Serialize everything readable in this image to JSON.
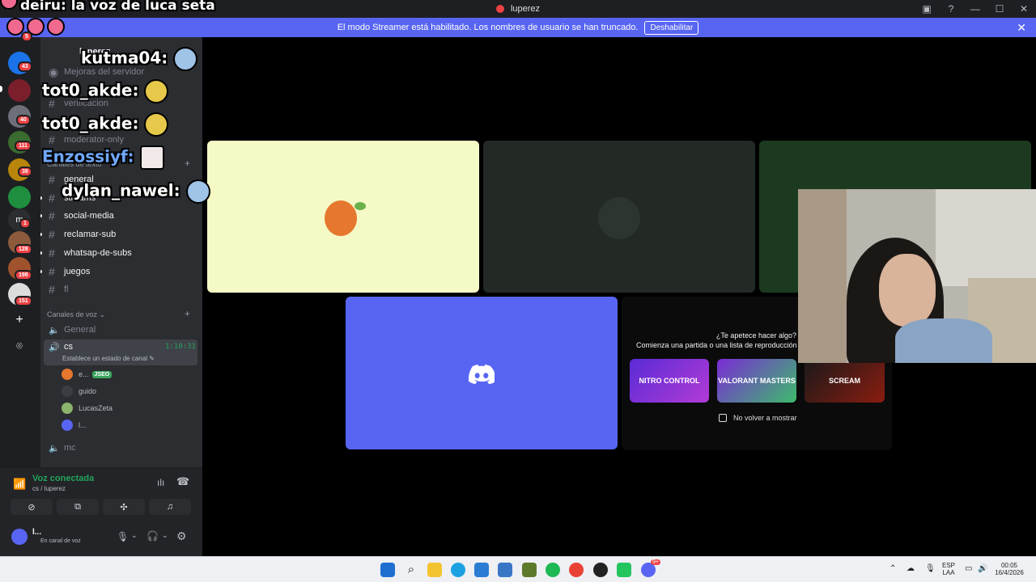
{
  "window": {
    "title": "luperez",
    "icons": {
      "app": "discord-red-icon"
    }
  },
  "banner": {
    "text": "El modo Streamer está habilitado. Los nombres de usuario se han truncado.",
    "button": "Deshabilitar",
    "close": "✕"
  },
  "overlay_top": {
    "text": "deiru: la voz de luca seta"
  },
  "chat": [
    {
      "user": "kutma04:",
      "color": "#ffffff"
    },
    {
      "user": "tot0_akde:",
      "color": "#ffffff"
    },
    {
      "user": "tot0_akde:",
      "color": "#ffffff"
    },
    {
      "user": "Enzossiyf:",
      "color": "#ffffff"
    },
    {
      "user": "dylan_nawel:",
      "color": "#ffffff"
    }
  ],
  "rail": {
    "badges": [
      "5",
      "43",
      "40",
      "111",
      "38",
      "1",
      "128",
      "198",
      "151"
    ]
  },
  "sidebar": {
    "server_name": "luperez",
    "boost": "Mejoras del servidor",
    "channels_top": [
      "verificacion",
      "moderator-only"
    ],
    "text_category": "Canales de texto",
    "text_channels": [
      "general",
      "streams",
      "social-media",
      "reclamar-sub",
      "whatsap-de-subs",
      "juegos",
      "fl"
    ],
    "voice_category": "Canales de voz",
    "voice_channels": {
      "general": "General",
      "cs": "cs",
      "cs_timer": "1:10:31",
      "cs_status": "Establece un estado de canal",
      "mc": "mc"
    },
    "voice_users": [
      {
        "name": "e...",
        "tag": "JSEO"
      },
      {
        "name": "guido"
      },
      {
        "name": "LucasZeta"
      },
      {
        "name": "l..."
      }
    ]
  },
  "voice_panel": {
    "status": "Voz conectada",
    "location": "cs / luperez",
    "user_name": "l...",
    "user_status": "En canal de voz"
  },
  "activity": {
    "title": "¿Te apetece hacer algo?",
    "subtitle": "Comienza una partida o una lista de reproducción",
    "cards": [
      "NITRO CONTROL",
      "VALORANT MASTERS",
      "SCREAM"
    ],
    "checkbox_label": "No volver a mostrar"
  },
  "taskbar": {
    "lang_top": "ESP",
    "lang_bottom": "LAA",
    "time": "00:05",
    "date": "16/4/2026",
    "discord_badge": "9+"
  },
  "colors": {
    "blurple": "#5865f2",
    "green": "#23a55a",
    "red": "#ed4245"
  }
}
